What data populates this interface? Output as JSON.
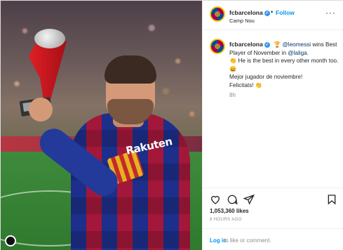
{
  "post": {
    "account": {
      "username": "fcbarcelona",
      "verified_glyph": "✓",
      "separator": "•",
      "follow_label": "Follow",
      "location": "Camp Nou"
    },
    "more_options_glyph": "···",
    "photo": {
      "sponsor_text": "Rakuten"
    },
    "caption": {
      "username": "fcbarcelona",
      "trophy_emoji": "🏆",
      "mention_1": "@leomessi",
      "text_1": " wins Best Player of November in ",
      "mention_2": "@laliga",
      "text_2": ".",
      "line_2": "👏 He is the best in every other month too. 😄",
      "line_3": "Mejor jugador de noviembre!",
      "line_4": "Felicitats! 👏"
    },
    "time_ago": "8h",
    "likes": "1,053,360 likes",
    "posted_date": "8 HOURS AGO",
    "login": {
      "link_label": "Log in",
      "rest_text": "to like or comment."
    }
  },
  "icons": {
    "like": "heart-icon",
    "comment": "comment-icon",
    "share": "share-icon",
    "save": "bookmark-icon",
    "more": "more-options-icon"
  },
  "colors": {
    "link_blue": "#0095f6",
    "verified_blue": "#3897f0",
    "text_dark": "#262626",
    "text_muted": "#8e8e8e"
  }
}
